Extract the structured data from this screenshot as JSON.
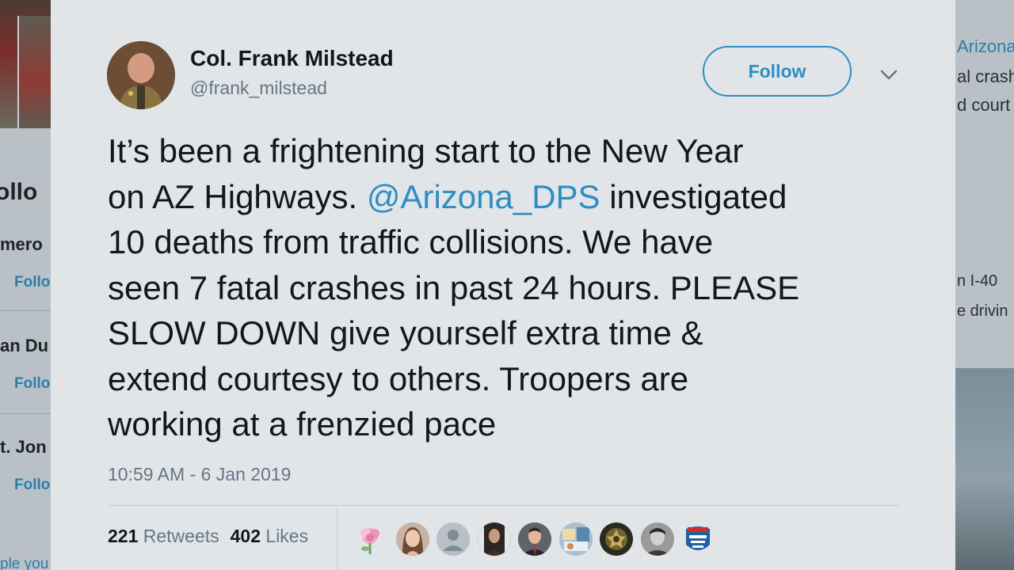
{
  "background_left": {
    "partial_texts": [
      "ollo",
      "mero",
      "Follo",
      "an Du",
      "Follo",
      "t. Jon",
      "Follo",
      "ple you"
    ]
  },
  "background_right": {
    "partial_texts": [
      "Arizona",
      "al crash",
      "d court",
      "n I-40",
      "e drivin"
    ]
  },
  "tweet": {
    "author_name": "Col. Frank Milstead",
    "author_handle": "@frank_milstead",
    "follow_label": "Follow",
    "text_lines": [
      "It’s been a frightening start to the New Year",
      "on AZ Highways. ",
      "@Arizona_DPS",
      " investigated",
      "10 deaths from traffic collisions. We have",
      "seen 7 fatal crashes in past 24 hours. PLEASE",
      "SLOW DOWN give yourself extra time &",
      "extend courtesy to others. Troopers are",
      "working at a frenzied pace"
    ],
    "timestamp": "10:59 AM - 6 Jan 2019",
    "retweets_count": "221",
    "retweets_label": "Retweets",
    "likes_count": "402",
    "likes_label": "Likes",
    "liker_avatars": [
      "flower-avatar",
      "woman-avatar",
      "default-avatar",
      "woman-dark-avatar",
      "man-suit-avatar",
      "collage-avatar",
      "badge-avatar",
      "man-bw-avatar",
      "sign-avatar"
    ]
  },
  "colors": {
    "accent": "#2b8fc4",
    "text": "#14171a",
    "muted": "#657786",
    "card": "#e1e5e8"
  }
}
